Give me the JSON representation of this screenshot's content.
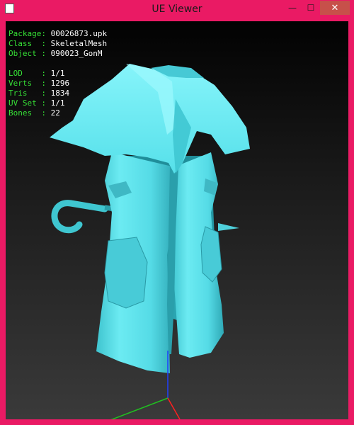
{
  "window": {
    "title": "UE Viewer",
    "controls": {
      "minimize": "—",
      "maximize": "☐",
      "close": "✕"
    },
    "frame_color": "#ea1a64"
  },
  "info": {
    "package": {
      "key": "Package:",
      "value": "00026873.upk"
    },
    "class": {
      "key": "Class  :",
      "value": "SkeletalMesh"
    },
    "object": {
      "key": "Object :",
      "value": "090023_GonM"
    },
    "lod": {
      "key": "LOD    :",
      "value": "1/1"
    },
    "verts": {
      "key": "Verts  :",
      "value": "1296"
    },
    "tris": {
      "key": "Tris   :",
      "value": "1834"
    },
    "uvset": {
      "key": "UV Set :",
      "value": "1/1"
    },
    "bones": {
      "key": "Bones  :",
      "value": "22"
    }
  },
  "scene": {
    "model_color": "#5fe8f0",
    "axis_colors": {
      "x": "#ff2020",
      "y": "#20c020",
      "z": "#2040ff"
    }
  }
}
